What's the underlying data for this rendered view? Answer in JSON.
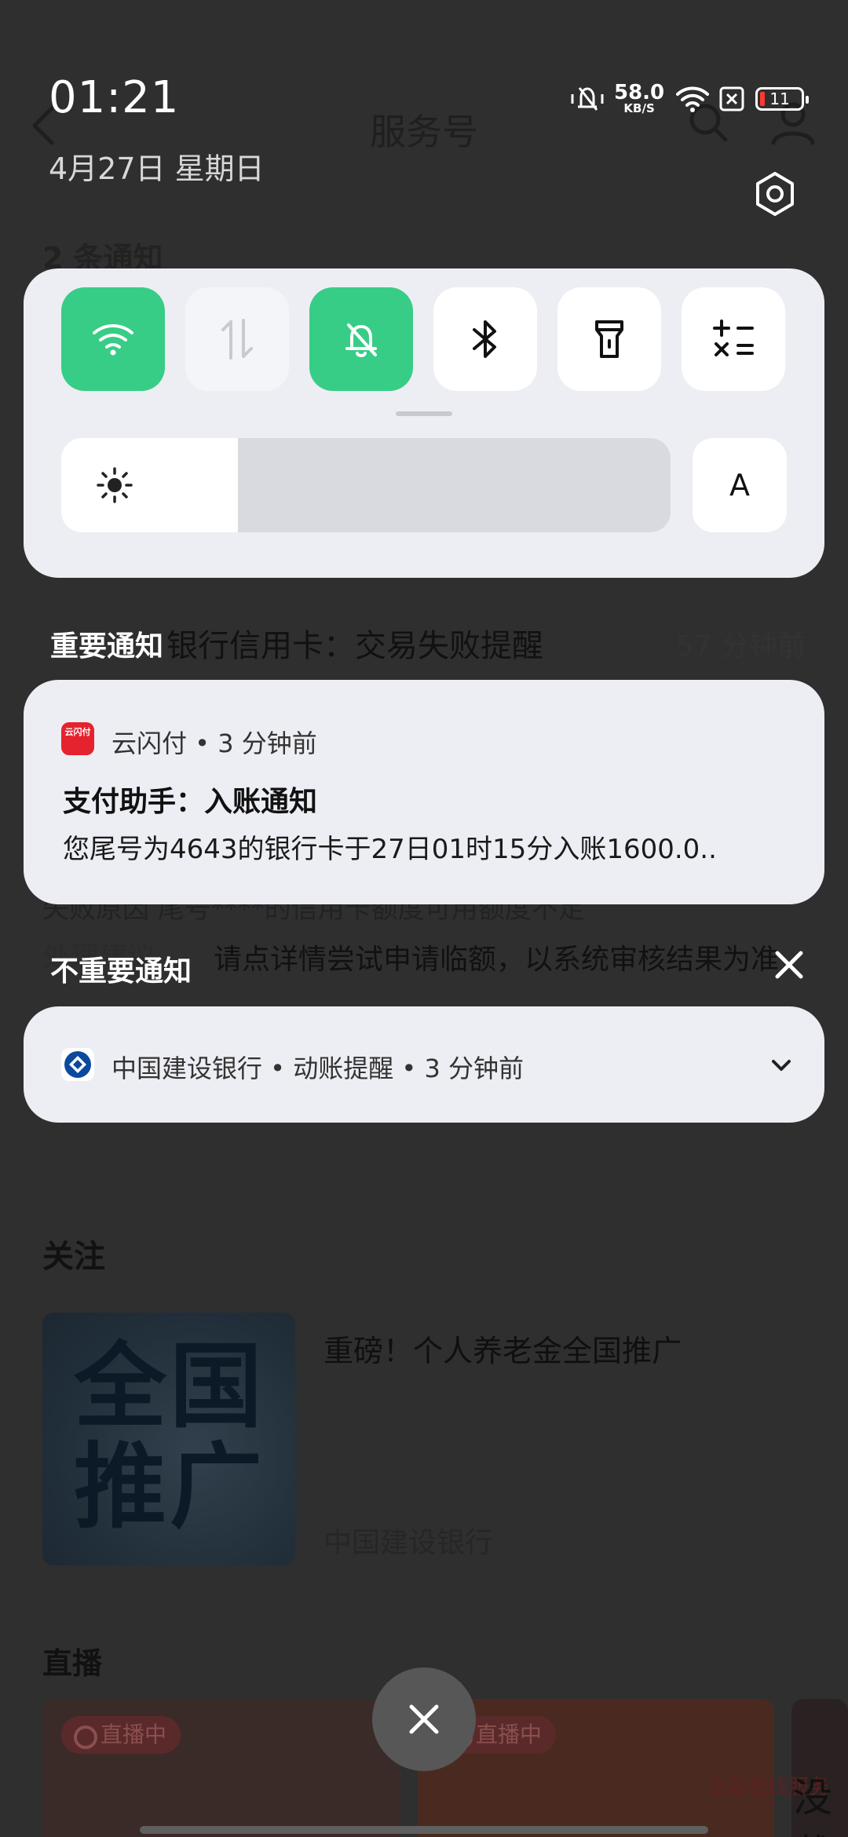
{
  "background_app": {
    "title": "服务号",
    "notice_count": "2 条通知",
    "notice_title": "银行信用卡：交易失败提醒",
    "notice_time": "57 分钟前",
    "partial_line": "失败原因    尾号****的信用卡额度可用额度不足",
    "suggest_label": "处理建议",
    "suggest_text": "请点详情尝试申请临额，以系统审核结果为准",
    "follow_heading": "关注",
    "cover_text": "全国推广",
    "article_title": "重磅！个人养老金全国推广",
    "article_source": "中国建设银行",
    "live_heading": "直播",
    "live_badge": "直播中",
    "live_brand_small": "金融在线服务",
    "live_brand_big": "没戴"
  },
  "status_bar": {
    "time": "01:21",
    "date": "4月27日  星期日",
    "net_speed_value": "58.0",
    "net_speed_unit": "KB/S",
    "battery": "11"
  },
  "quick_settings": {
    "tiles": [
      {
        "name": "wifi",
        "icon": "wifi-icon",
        "on": true
      },
      {
        "name": "mobile-data",
        "icon": "mobile-data-icon",
        "on": false,
        "disabled": true
      },
      {
        "name": "silent",
        "icon": "bell-off-icon",
        "on": true
      },
      {
        "name": "bluetooth",
        "icon": "bluetooth-icon",
        "on": false
      },
      {
        "name": "flashlight",
        "icon": "flashlight-icon",
        "on": false
      },
      {
        "name": "calculator",
        "icon": "calculator-icon",
        "on": false
      }
    ],
    "brightness_level": 0.29,
    "auto_label": "A",
    "active_color": "#37cd86"
  },
  "important_notifications": {
    "label": "重要通知",
    "items": [
      {
        "app_icon_text": "云闪付",
        "meta": "云闪付 • 3 分钟前",
        "title": "支付助手：入账通知",
        "body": "您尾号为4643的银行卡于27日01时15分入账1600.0.."
      }
    ]
  },
  "unimportant_notifications": {
    "label": "不重要通知",
    "items": [
      {
        "meta": "中国建设银行 • 动账提醒 • 3 分钟前"
      }
    ]
  }
}
